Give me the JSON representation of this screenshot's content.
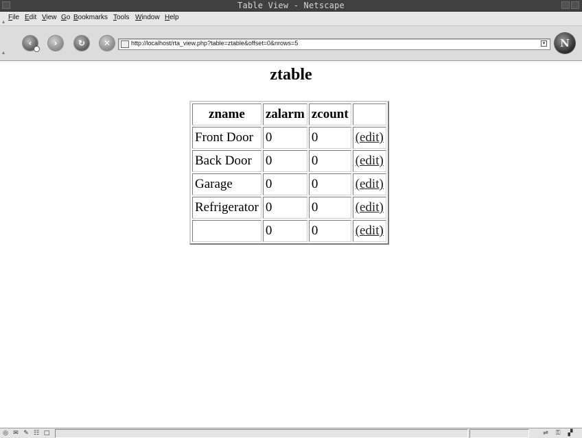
{
  "window": {
    "title": "Table View - Netscape"
  },
  "menu": {
    "items": [
      {
        "pre": "",
        "ul": "F",
        "post": "ile"
      },
      {
        "pre": "",
        "ul": "E",
        "post": "dit"
      },
      {
        "pre": "",
        "ul": "V",
        "post": "iew"
      },
      {
        "pre": "",
        "ul": "G",
        "post": "o"
      },
      {
        "pre": "",
        "ul": "B",
        "post": "ookmarks"
      },
      {
        "pre": "",
        "ul": "T",
        "post": "ools"
      },
      {
        "pre": "",
        "ul": "W",
        "post": "indow"
      },
      {
        "pre": "",
        "ul": "H",
        "post": "elp"
      }
    ]
  },
  "nav": {
    "url": "http://localhost/rta_view.php?table=ztable&offset=0&nrows=5",
    "logo_letter": "N",
    "back_icon": "back-arrow-icon",
    "forward_icon": "forward-arrow-icon",
    "reload_icon": "reload-icon",
    "stop_icon": "stop-icon"
  },
  "page": {
    "title": "ztable",
    "columns": [
      "zname",
      "zalarm",
      "zcount",
      ""
    ],
    "rows": [
      {
        "zname": "Front Door",
        "zalarm": "0",
        "zcount": "0",
        "action": "(edit)"
      },
      {
        "zname": "Back Door",
        "zalarm": "0",
        "zcount": "0",
        "action": "(edit)"
      },
      {
        "zname": "Garage",
        "zalarm": "0",
        "zcount": "0",
        "action": "(edit)"
      },
      {
        "zname": "Refrigerator",
        "zalarm": "0",
        "zcount": "0",
        "action": "(edit)"
      },
      {
        "zname": "",
        "zalarm": "0",
        "zcount": "0",
        "action": "(edit)"
      }
    ]
  },
  "status": {
    "icons": [
      "navigator-icon",
      "mail-icon",
      "composer-icon",
      "address-book-icon",
      "chat-icon"
    ],
    "right_icons": [
      "connection-icon",
      "security-lock-icon"
    ]
  }
}
